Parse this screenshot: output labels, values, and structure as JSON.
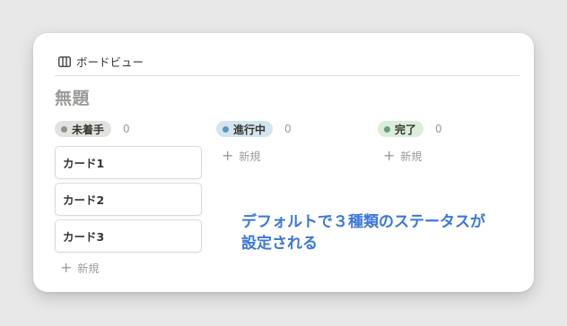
{
  "view_tab": {
    "icon": "board-icon",
    "label": "ボードビュー"
  },
  "page": {
    "title": "無題"
  },
  "columns": [
    {
      "status": "未着手",
      "count": "0",
      "pill_color": "#e3e2e0",
      "dot_color": "#91918e",
      "cards": [
        "カード1",
        "カード2",
        "カード3"
      ],
      "new_label": "新規"
    },
    {
      "status": "進行中",
      "count": "0",
      "pill_color": "#d3e5ef",
      "dot_color": "#5b97bd",
      "cards": [],
      "new_label": "新規"
    },
    {
      "status": "完了",
      "count": "0",
      "pill_color": "#dbeddb",
      "dot_color": "#6c9b7d",
      "cards": [],
      "new_label": "新規"
    }
  ],
  "annotation": {
    "line1": "デフォルトで３種類のステータスが",
    "line2": "設定される",
    "color": "#3b78d8"
  }
}
